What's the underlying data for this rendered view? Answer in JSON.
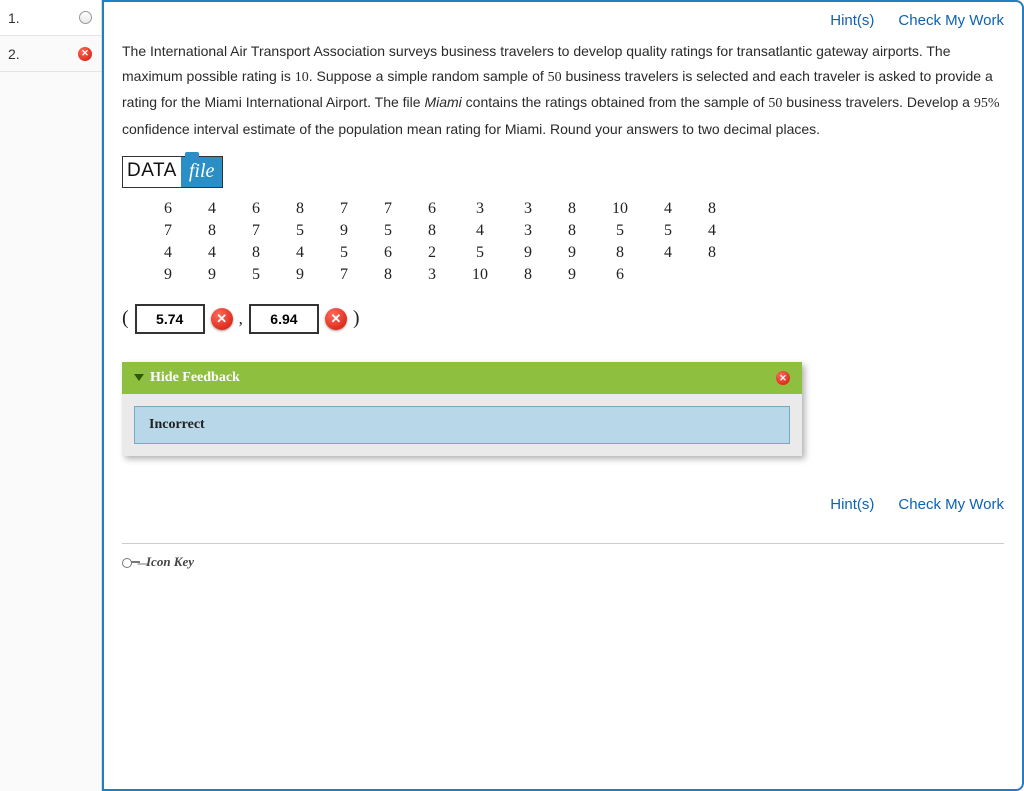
{
  "sidebar": {
    "items": [
      {
        "num": "1.",
        "status": "empty"
      },
      {
        "num": "2.",
        "status": "wrong"
      }
    ]
  },
  "links": {
    "hints": "Hint(s)",
    "check": "Check My Work"
  },
  "question": {
    "p1a": "The International Air Transport Association surveys business travelers to develop quality ratings for transatlantic gateway airports. The maximum possible rating is ",
    "v10": "10",
    "p1b": ". Suppose a simple random sample of ",
    "v50": "50",
    "p1c": " business travelers is selected and each traveler is asked to provide a rating for the Miami International Airport. The file ",
    "miami": "Miami",
    "p1d": " contains the ratings obtained from the sample of ",
    "v50b": "50",
    "p1e": " business travelers. Develop a ",
    "v95": "95%",
    "p1f": " confidence interval estimate of the population mean rating for Miami. Round your answers to two decimal places."
  },
  "datafile": {
    "data": "DATA",
    "file": "file"
  },
  "table": [
    [
      "6",
      "4",
      "6",
      "8",
      "7",
      "7",
      "6",
      "3",
      "3",
      "8",
      "10",
      "4",
      "8"
    ],
    [
      "7",
      "8",
      "7",
      "5",
      "9",
      "5",
      "8",
      "4",
      "3",
      "8",
      "5",
      "5",
      "4"
    ],
    [
      "4",
      "4",
      "8",
      "4",
      "5",
      "6",
      "2",
      "5",
      "9",
      "9",
      "8",
      "4",
      "8"
    ],
    [
      "9",
      "9",
      "5",
      "9",
      "7",
      "8",
      "3",
      "10",
      "8",
      "9",
      "6",
      "",
      ""
    ]
  ],
  "answers": {
    "open_paren": "(",
    "comma": ",",
    "close_paren": ")",
    "lower": "5.74",
    "upper": "6.94"
  },
  "feedback": {
    "header": "Hide Feedback",
    "message": "Incorrect"
  },
  "icon_key": "Icon Key"
}
